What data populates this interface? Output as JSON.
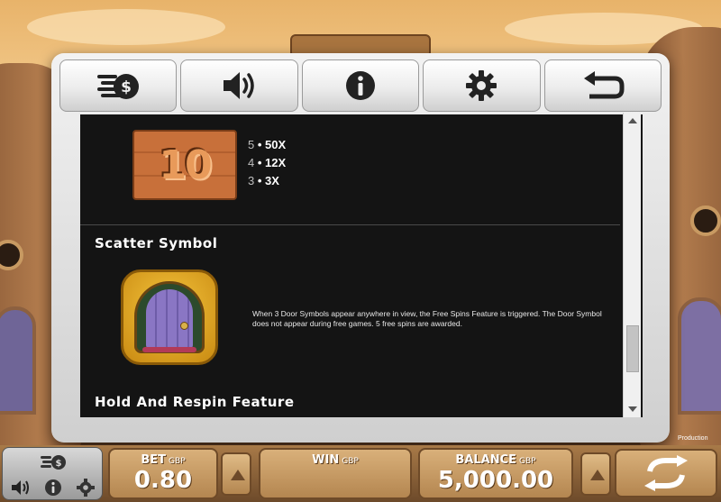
{
  "toolbar": {
    "buttons": [
      {
        "name": "paytable-stake-button",
        "icon": "coins-stack-icon"
      },
      {
        "name": "sound-button",
        "icon": "speaker-icon"
      },
      {
        "name": "info-button",
        "icon": "info-icon"
      },
      {
        "name": "settings-button",
        "icon": "gear-icon"
      },
      {
        "name": "back-button",
        "icon": "return-arrow-icon"
      }
    ]
  },
  "paytable": {
    "ten_symbol": {
      "label": "10",
      "payouts": [
        {
          "count": "5",
          "multiplier": "• 50X"
        },
        {
          "count": "4",
          "multiplier": "• 12X"
        },
        {
          "count": "3",
          "multiplier": "• 3X"
        }
      ]
    },
    "scatter": {
      "heading": "Scatter Symbol",
      "icon": "door-symbol-icon",
      "description": "When 3 Door Symbols appear anywhere in view, the Free Spins Feature is triggered. The Door Symbol does not appear during free games. 5 free spins are awarded."
    },
    "hold_heading": "Hold And Respin Feature"
  },
  "bottom_bar": {
    "bet": {
      "label": "BET",
      "currency": "GBP",
      "value": "0.80"
    },
    "win": {
      "label": "WIN",
      "currency": "GBP",
      "value": ""
    },
    "balance": {
      "label": "BALANCE",
      "currency": "GBP",
      "value": "5,000.00"
    }
  },
  "brand": {
    "prefix": "",
    "accent": "",
    "suffix": "Production"
  },
  "colors": {
    "panel_bg": "#141414",
    "text": "#ffffff",
    "stone": "#c89a62"
  }
}
